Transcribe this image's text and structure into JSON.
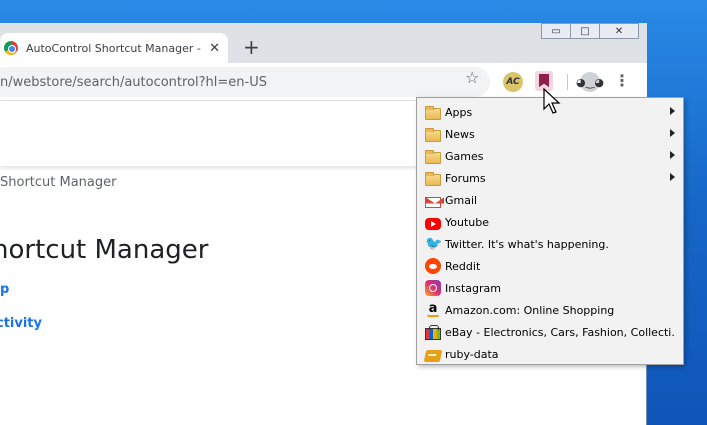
{
  "browser": {
    "tab_title": "AutoControl Shortcut Manager - Chr",
    "tab_close": "✕",
    "new_tab": "+",
    "url": "n/webstore/search/autocontrol?hl=en-US",
    "window_controls": {
      "minimize": "▭",
      "maximize": "□",
      "close": "✕"
    },
    "ext_ac_label": "AC",
    "profile_glyph": "◕‿◕",
    "menu_glyph": "⋮",
    "star_glyph": "☆"
  },
  "page": {
    "breadcrumb": "Shortcut Manager",
    "heading": "hortcut Manager",
    "link1": "p",
    "link2": "ctivity"
  },
  "bookmarks_menu": {
    "items": [
      {
        "label": "Apps",
        "icon": "folder-icon",
        "submenu": true
      },
      {
        "label": "News",
        "icon": "folder-icon",
        "submenu": true
      },
      {
        "label": "Games",
        "icon": "folder-icon",
        "submenu": true
      },
      {
        "label": "Forums",
        "icon": "folder-icon",
        "submenu": true
      },
      {
        "label": "Gmail",
        "icon": "gmail-icon",
        "submenu": false
      },
      {
        "label": "Youtube",
        "icon": "youtube-icon",
        "submenu": false
      },
      {
        "label": "Twitter. It's what's happening.",
        "icon": "twitter-icon",
        "submenu": false
      },
      {
        "label": "Reddit",
        "icon": "reddit-icon",
        "submenu": false
      },
      {
        "label": "Instagram",
        "icon": "instagram-icon",
        "submenu": false
      },
      {
        "label": "Amazon.com: Online Shopping",
        "icon": "amazon-icon",
        "submenu": false
      },
      {
        "label": "eBay - Electronics, Cars, Fashion, Collecti...",
        "icon": "ebay-icon",
        "submenu": false
      },
      {
        "label": "ruby-data",
        "icon": "ruby-icon",
        "submenu": false
      }
    ]
  },
  "icons": {
    "twitter_glyph": "🐦",
    "amazon_glyph": "a"
  },
  "colors": {
    "desktop": "#1a6fd0",
    "link": "#1a73e8",
    "bookmark_ext": "#8f1f4b"
  }
}
